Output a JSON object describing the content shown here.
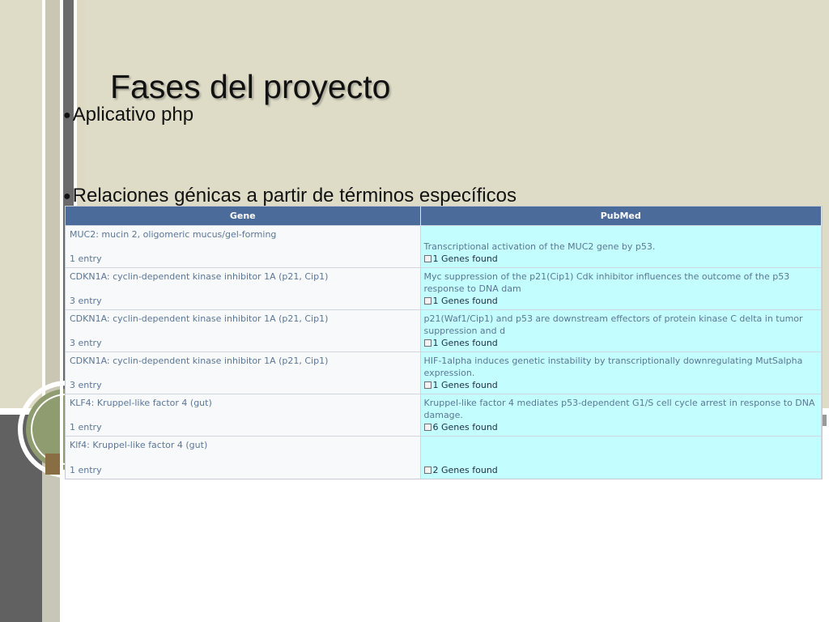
{
  "slide": {
    "title": "Fases del proyecto",
    "bullets": [
      "Aplicativo php",
      "Relaciones génicas a partir de términos específicos"
    ]
  },
  "table": {
    "headers": [
      "Gene",
      "PubMed"
    ],
    "rows": [
      {
        "gene": "MUC2: mucin 2, oligomeric mucus/gel-forming",
        "entries": "1 entry",
        "pubmed_title": "Transcriptional activation of the MUC2 gene by p53.",
        "found": "1 Genes found"
      },
      {
        "gene": "CDKN1A: cyclin-dependent kinase inhibitor 1A (p21, Cip1)",
        "entries": "3 entry",
        "pubmed_title": "Myc suppression of the p21(Cip1) Cdk inhibitor influences the outcome of the p53 response to DNA dam",
        "found": "1 Genes found"
      },
      {
        "gene": "CDKN1A: cyclin-dependent kinase inhibitor 1A (p21, Cip1)",
        "entries": "3 entry",
        "pubmed_title": "p21(Waf1/Cip1) and p53 are downstream effectors of protein kinase C delta in tumor suppression and d",
        "found": "1 Genes found"
      },
      {
        "gene": "CDKN1A: cyclin-dependent kinase inhibitor 1A (p21, Cip1)",
        "entries": "3 entry",
        "pubmed_title": "HIF-1alpha induces genetic instability by transcriptionally downregulating MutSalpha expression.",
        "found": "1 Genes found"
      },
      {
        "gene": "KLF4: Kruppel-like factor 4 (gut)",
        "entries": "1 entry",
        "pubmed_title": "Kruppel-like factor 4 mediates p53-dependent G1/S cell cycle arrest in response to DNA damage.",
        "found": "6 Genes found"
      },
      {
        "gene": "Klf4: Kruppel-like factor 4 (gut)",
        "entries": "1 entry",
        "pubmed_title": "",
        "found": "2 Genes found"
      }
    ]
  },
  "colors": {
    "background": "#dedcc7",
    "header": "#4b6b9a",
    "pubmed_cell": "#c4fdfd",
    "gene_text": "#5b7797"
  }
}
